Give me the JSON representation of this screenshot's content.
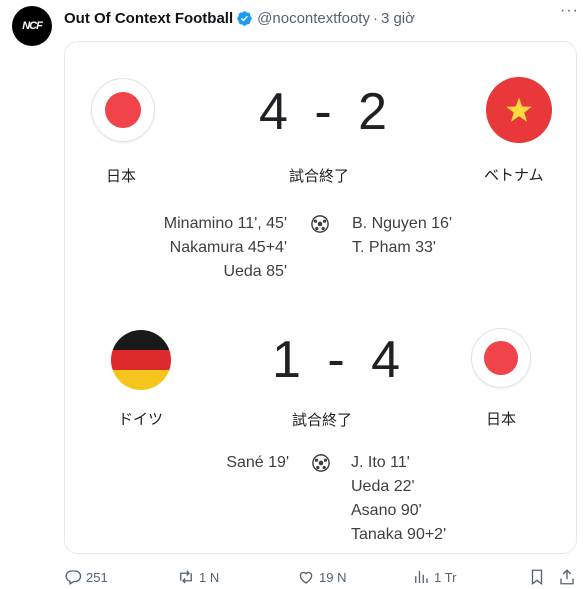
{
  "post": {
    "author_name": "Out Of Context Football",
    "avatar_text": "NCF",
    "handle": "@nocontextfooty",
    "separator": "·",
    "time": "3 giờ",
    "more_label": "···"
  },
  "matches": [
    {
      "home_team": "日本",
      "away_team": "ベトナム",
      "score": "4 - 2",
      "status": "試合終了",
      "home_scorers": [
        "Minamino 11', 45'",
        "Nakamura 45+4'",
        "Ueda 85'"
      ],
      "away_scorers": [
        "B.  Nguyen 16'",
        "T.  Pham 33'"
      ],
      "home_flag": "japan-flag",
      "away_flag": "vietnam-flag"
    },
    {
      "home_team": "ドイツ",
      "away_team": "日本",
      "score": "1 - 4",
      "status": "試合終了",
      "home_scorers": [
        "Sané 19'"
      ],
      "away_scorers": [
        "J.  Ito 11'",
        "Ueda 22'",
        "Asano 90'",
        "Tanaka 90+2'"
      ],
      "home_flag": "germany-flag",
      "away_flag": "japan-flag"
    }
  ],
  "actions": {
    "replies": "251",
    "reposts": "1 N",
    "likes": "19 N",
    "views": "1 Tr"
  },
  "colors": {
    "accent_verified": "#1d9bf0",
    "text_secondary": "#536471",
    "japan_red": "#f0444a",
    "vietnam_red": "#e8383a"
  }
}
